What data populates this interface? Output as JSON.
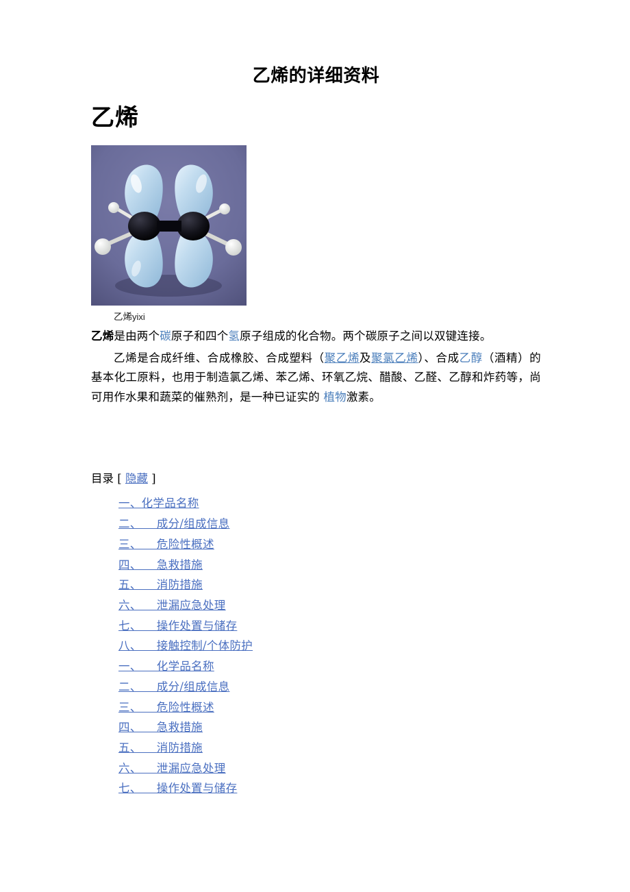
{
  "document": {
    "title": "乙烯的详细资料",
    "heading": "乙烯"
  },
  "figure": {
    "alt_name": "ethylene-molecular-model-photo",
    "caption_cn": "乙烯",
    "caption_pinyin": "yixi",
    "background_color": "#6b6d9a",
    "lobe_color": "#b9d4ea",
    "atom_color": "#0c0c14",
    "hydrogen_color": "#f2f2ee"
  },
  "paragraphs": {
    "p1": {
      "bold_lead": "乙烯",
      "seg1": "是由两个",
      "link_carbon": "碳",
      "seg2": "原子和四个",
      "link_hydrogen": "氢",
      "seg3": "原子组成的化合物。两个碳原子之间以双键连接。"
    },
    "p2": {
      "seg1": "乙烯是合成纤维、合成橡胶、合成塑料（",
      "link_pe": "聚乙烯",
      "seg2": "及",
      "link_pvc": "聚氯乙烯",
      "seg3": "）、合成",
      "link_ethanol": "乙醇",
      "seg4": "（酒精）的基本化工原料，也用于制造氯乙烯、苯乙烯、环氧乙烷、醋酸、乙醛、乙醇和炸药等，尚可用作水果和蔬菜的催熟剂，是一种已证实的 ",
      "link_plant": "植物",
      "seg5": "激素。"
    }
  },
  "toc": {
    "label": "目录 [ ",
    "toggle": "隐藏",
    "label_end": " ]",
    "items": [
      {
        "text": "一、化学品名称"
      },
      {
        "text": "二、    成分/组成信息"
      },
      {
        "text": "三、    危险性概述"
      },
      {
        "text": "四、    急救措施"
      },
      {
        "text": "五、    消防措施"
      },
      {
        "text": "六、    泄漏应急处理"
      },
      {
        "text": "七、    操作处置与储存"
      },
      {
        "text": "八、    接触控制/个体防护"
      },
      {
        "text": "一、    化学品名称"
      },
      {
        "text": "二、    成分/组成信息"
      },
      {
        "text": "三、    危险性概述"
      },
      {
        "text": "四、    急救措施"
      },
      {
        "text": "五、    消防措施"
      },
      {
        "text": "六、    泄漏应急处理"
      },
      {
        "text": "七、    操作处置与储存"
      }
    ]
  },
  "colors": {
    "link_blue": "#4a6fc0",
    "inline_link_blue": "#4a7ebb",
    "text_black": "#000000",
    "page_background": "#ffffff"
  }
}
